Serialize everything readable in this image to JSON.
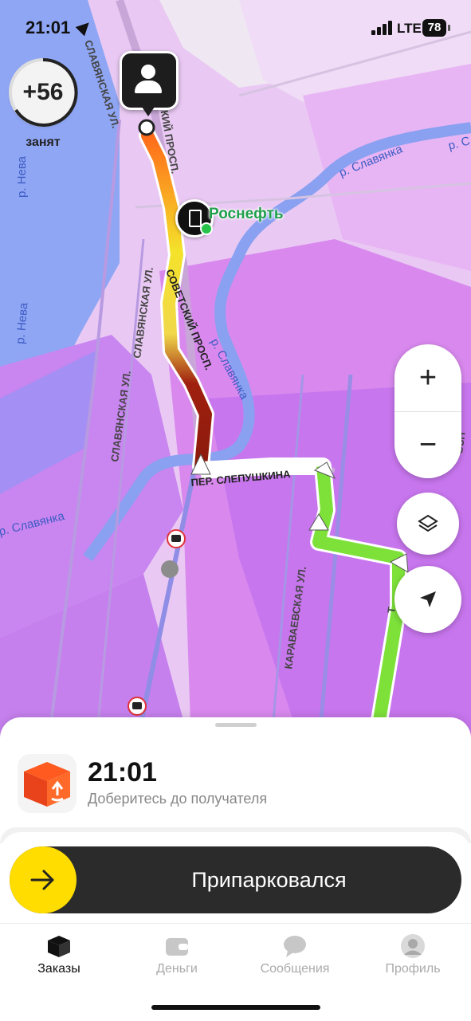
{
  "status_bar": {
    "time": "21:01",
    "network": "LTE",
    "battery": "78"
  },
  "driver": {
    "rating_delta": "+56",
    "state": "занят"
  },
  "map": {
    "labels": {
      "slav_ul_top": "СЛАВЯНСКАЯ УЛ.",
      "sov_prosp_top": "СКИЙ ПРОСП.",
      "sov_prosp_mid": "СОВЕТСКИЙ ПРОСП.",
      "slav_ul_left1": "СЛАВЯНСКАЯ УЛ.",
      "slav_ul_left2": "СЛАВЯНСКАЯ УЛ.",
      "slep_lane": "ПЕР. СЛЕПУШКИНА",
      "karav_ul": "КАРАВАЕВСКАЯ УЛ.",
      "neva_top": "р. Нева",
      "neva_mid": "р. Нева",
      "slavyanka_top": "р. Славянка",
      "slavyanka_top2": "р. С",
      "slavyanka_mid": "р. Славянка",
      "slavyanka_left": "р. Славянка",
      "tr_label": "Т",
      "ozn_label": "ОЗН"
    },
    "poi": {
      "fuel_station": "Роснефть"
    },
    "controls": {
      "zoom_in": "+",
      "zoom_out": "−"
    }
  },
  "order": {
    "eta": "21:01",
    "instruction": "Доберитесь до получателя"
  },
  "action": {
    "slider_label": "Припарковался"
  },
  "tabs": [
    {
      "label": "Заказы",
      "icon": "box-icon",
      "active": true
    },
    {
      "label": "Деньги",
      "icon": "wallet-icon",
      "active": false
    },
    {
      "label": "Сообщения",
      "icon": "chat-icon",
      "active": false
    },
    {
      "label": "Профиль",
      "icon": "avatar-icon",
      "active": false
    }
  ],
  "colors": {
    "accent": "#ffdd00",
    "route_free": "#7ee13a",
    "route_heavy": "#8b1a0d",
    "surge": "#d77ff0"
  }
}
